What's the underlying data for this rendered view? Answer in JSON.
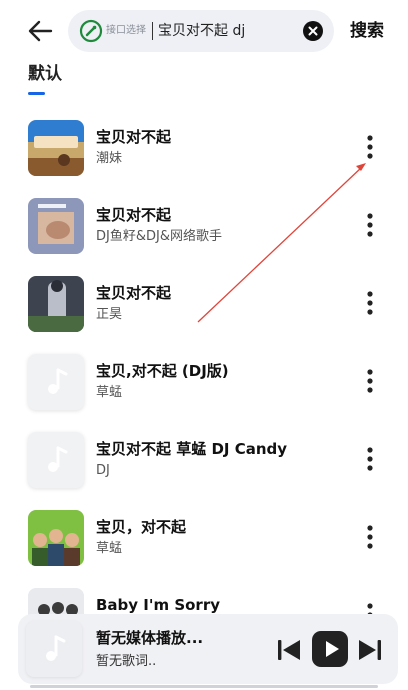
{
  "header": {
    "back_icon": "arrow-left-icon",
    "search": {
      "interface_icon": "interface-switch-icon",
      "interface_label": "接口选择",
      "query": "宝贝对不起 dj",
      "clear_icon": "close-circle-icon"
    },
    "search_button": "搜索"
  },
  "tabs": [
    {
      "label": "默认",
      "active": true
    }
  ],
  "accent_color": "#1565e6",
  "songs": [
    {
      "title": "宝贝对不起",
      "artist": "潮妹",
      "cover": "photo"
    },
    {
      "title": "宝贝对不起",
      "artist": "DJ鱼籽&DJ&网络歌手",
      "cover": "photo"
    },
    {
      "title": "宝贝对不起",
      "artist": "正昊",
      "cover": "photo"
    },
    {
      "title": "宝贝,对不起 (DJ版)",
      "artist": "草蜢",
      "cover": "placeholder"
    },
    {
      "title": "宝贝对不起 草蜢 DJ Candy",
      "artist": "DJ",
      "cover": "placeholder"
    },
    {
      "title": "宝贝，对不起",
      "artist": "草蜢",
      "cover": "photo"
    },
    {
      "title": "Baby I'm Sorry",
      "artist": "",
      "cover": "photo"
    }
  ],
  "annotation": {
    "type": "arrow",
    "color": "#e0453a"
  },
  "player": {
    "title": "暂无媒体播放...",
    "subtitle": "暂无歌词..",
    "prev_icon": "skip-previous-icon",
    "play_icon": "play-icon",
    "next_icon": "skip-next-icon"
  }
}
